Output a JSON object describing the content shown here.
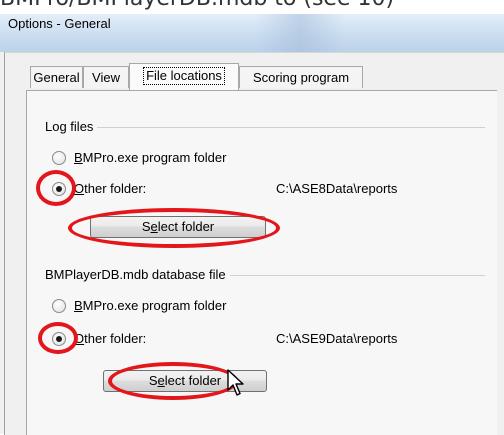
{
  "caption": "BMPro/BMPlayerDB.mdb to (see 10)",
  "window": {
    "title": "Options - General"
  },
  "tabs": [
    {
      "label": "General"
    },
    {
      "label": "View"
    },
    {
      "label": "File locations"
    },
    {
      "label": "Scoring program"
    }
  ],
  "active_tab": "File locations",
  "log_files": {
    "group_label": "Log files",
    "option_program_folder": {
      "label": "BMPro.exe program folder",
      "mnemonic": "B",
      "rest": "MPro.exe program folder",
      "checked": false
    },
    "option_other_folder": {
      "label": "Other folder:",
      "mnemonic": "O",
      "rest": "ther folder:",
      "checked": true
    },
    "path": "C:\\ASE8Data\\reports",
    "select_button": {
      "label": "Select folder",
      "pre": "S",
      "mnemonic": "e",
      "post": "lect folder"
    }
  },
  "db_file": {
    "group_label": "BMPlayerDB.mdb database file",
    "option_program_folder": {
      "label": "BMPro.exe program folder",
      "mnemonic": "B",
      "rest": "MPro.exe program folder",
      "checked": false
    },
    "option_other_folder": {
      "label": "Other folder:",
      "mnemonic": "O",
      "rest": "ther folder:",
      "checked": true
    },
    "path": "C:\\ASE9Data\\reports",
    "select_button": {
      "label": "Select folder",
      "pre": "S",
      "mnemonic": "e",
      "post": "lect folder"
    }
  },
  "colors": {
    "highlight_ring": "#e3161b",
    "title_bar": "#c9dcf0",
    "dialog_bg": "#f0f0f0"
  },
  "icons": {
    "cursor": "arrow-cursor-icon"
  }
}
